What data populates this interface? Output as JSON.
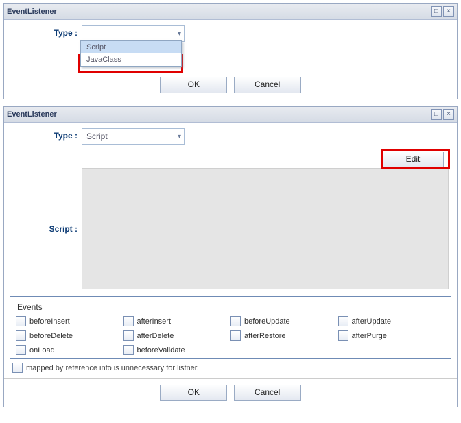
{
  "dialog1": {
    "title": "EventListener",
    "type_label": "Type :",
    "dropdown": {
      "selected": "",
      "options": [
        "Script",
        "JavaClass"
      ]
    },
    "ok": "OK",
    "cancel": "Cancel"
  },
  "dialog2": {
    "title": "EventListener",
    "type_label": "Type :",
    "type_value": "Script",
    "script_label": "Script :",
    "edit": "Edit",
    "events_label": "Events",
    "events": [
      "beforeInsert",
      "afterInsert",
      "beforeUpdate",
      "afterUpdate",
      "beforeDelete",
      "afterDelete",
      "afterRestore",
      "afterPurge",
      "onLoad",
      "beforeValidate"
    ],
    "mapped_label": "mapped by reference info is unnecessary for listner.",
    "ok": "OK",
    "cancel": "Cancel"
  }
}
